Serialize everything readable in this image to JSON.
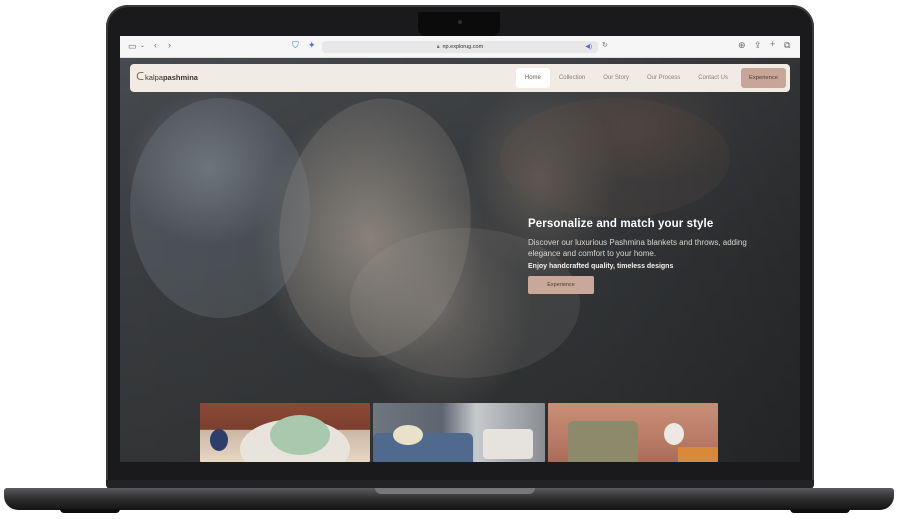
{
  "browser": {
    "url": "np.explorug.com",
    "icons": [
      "sidebar-icon",
      "chevron-down-icon",
      "back-icon",
      "forward-icon",
      "shield-icon",
      "extension-icon",
      "lock-icon",
      "audio-icon",
      "reload-icon",
      "download-icon",
      "share-icon",
      "new-tab-icon",
      "tabs-icon"
    ]
  },
  "site": {
    "logo": {
      "light": "kalpa",
      "bold": "pashmina"
    },
    "nav": [
      {
        "label": "Home",
        "active": true
      },
      {
        "label": "Collection",
        "active": false
      },
      {
        "label": "Our Story",
        "active": false
      },
      {
        "label": "Our Process",
        "active": false
      },
      {
        "label": "Contact Us",
        "active": false
      }
    ],
    "nav_cta": "Experience",
    "hero": {
      "title": "Personalize and match your style",
      "subtitle": "Discover our luxurious Pashmina blankets and throws, adding elegance and comfort to your home.",
      "tagline": "Enjoy handcrafted quality, timeless designs",
      "cta": "Experience"
    }
  },
  "colors": {
    "nav_bg": "#f1ece3",
    "accent": "#c7a699"
  }
}
